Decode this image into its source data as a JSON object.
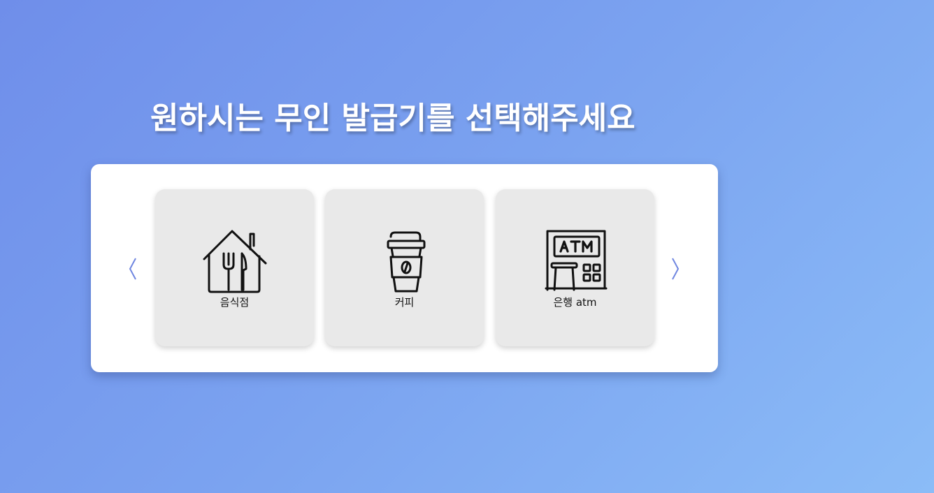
{
  "page": {
    "title": "원하시는 무인 발급기를 선택해주세요"
  },
  "carousel": {
    "prev_icon": "chevron-left-icon",
    "next_icon": "chevron-right-icon",
    "arrow_color": "#6f86e0",
    "cards": [
      {
        "label": "음식점",
        "icon": "restaurant-house-icon"
      },
      {
        "label": "커피",
        "icon": "coffee-cup-icon"
      },
      {
        "label": "은행 atm",
        "icon": "atm-machine-icon"
      }
    ]
  },
  "colors": {
    "background_start": "#6f8eea",
    "background_end": "#8bbcf7",
    "panel": "#ffffff",
    "card": "#e9e9e9"
  }
}
